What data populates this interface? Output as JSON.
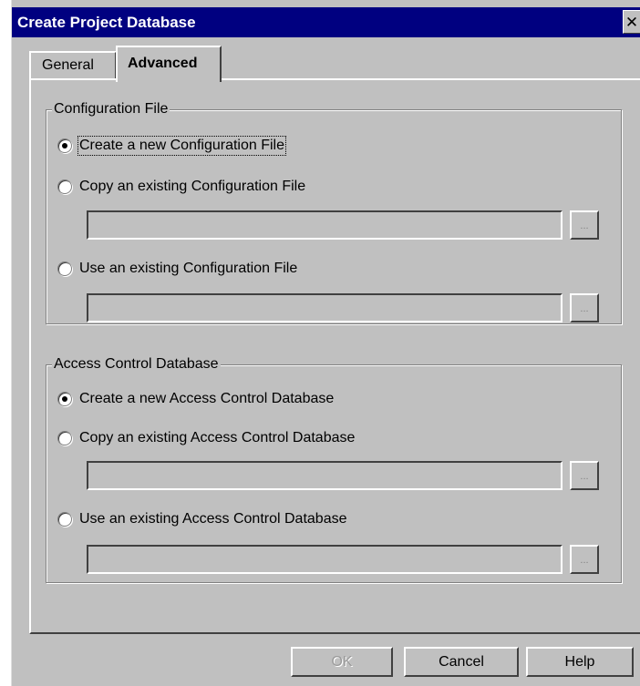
{
  "window": {
    "title": "Create Project Database",
    "close_glyph": "✕"
  },
  "tabs": [
    {
      "label": "General",
      "selected": false
    },
    {
      "label": "Advanced",
      "selected": true
    }
  ],
  "config_group": {
    "legend": "Configuration File",
    "options": [
      {
        "label": "Create a new Configuration File",
        "checked": true
      },
      {
        "label": "Copy an existing Configuration File",
        "checked": false
      },
      {
        "label": "Use an existing Configuration File",
        "checked": false
      }
    ],
    "copy_path_value": "",
    "use_path_value": ""
  },
  "acl_group": {
    "legend": "Access Control Database",
    "options": [
      {
        "label": "Create a new Access Control Database",
        "checked": true
      },
      {
        "label": "Copy an existing Access Control Database",
        "checked": false
      },
      {
        "label": "Use an existing Access Control Database",
        "checked": false
      }
    ],
    "copy_path_value": "",
    "use_path_value": ""
  },
  "browse_label": "...",
  "buttons": {
    "ok": "OK",
    "cancel": "Cancel",
    "help": "Help"
  }
}
